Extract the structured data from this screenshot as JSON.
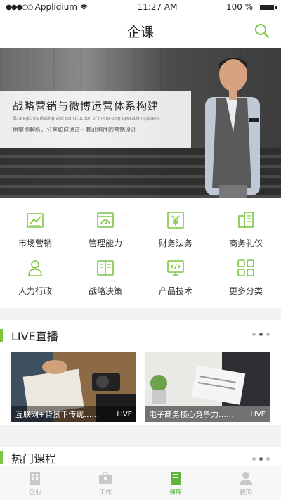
{
  "status_bar": {
    "carrier": "Applidium",
    "time": "11:27 AM",
    "battery": "100 %"
  },
  "nav": {
    "title": "企课"
  },
  "banner": {
    "title": "战略营销与微博运营体系构建",
    "subtitle_en": "Strategic marketing and construction of micro-blog operation system",
    "subtitle_cn": "用案例解析，分享如何通过一套战略性的营销设计"
  },
  "categories": [
    {
      "label": "市场营销",
      "icon": "chart-icon"
    },
    {
      "label": "管理能力",
      "icon": "dashboard-icon"
    },
    {
      "label": "财务法务",
      "icon": "yen-icon"
    },
    {
      "label": "商务礼仪",
      "icon": "building-icon"
    },
    {
      "label": "人力行政",
      "icon": "person-icon"
    },
    {
      "label": "战略决策",
      "icon": "book-icon"
    },
    {
      "label": "产品技术",
      "icon": "monitor-code-icon"
    },
    {
      "label": "更多分类",
      "icon": "grid-icon"
    }
  ],
  "live": {
    "title": "LIVE直播",
    "cards": [
      {
        "caption": "互联网+背景下传统……",
        "tag": "LIVE"
      },
      {
        "caption": "电子商务核心竞争力……",
        "tag": "LIVE"
      }
    ]
  },
  "hot": {
    "title": "热门课程"
  },
  "tabs": [
    {
      "label": "企业",
      "icon": "company-icon",
      "active": false
    },
    {
      "label": "工作",
      "icon": "briefcase-icon",
      "active": false
    },
    {
      "label": "课库",
      "icon": "library-icon",
      "active": true
    },
    {
      "label": "我的",
      "icon": "profile-icon",
      "active": false
    }
  ],
  "colors": {
    "accent": "#7cc540",
    "tab_active": "#5db53a"
  }
}
